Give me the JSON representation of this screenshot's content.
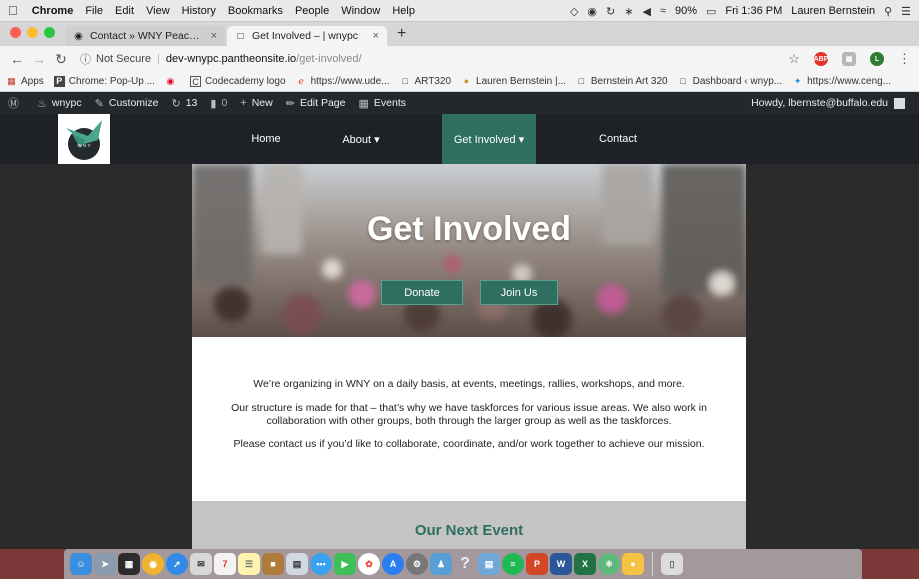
{
  "macos": {
    "menus": [
      "Chrome",
      "File",
      "Edit",
      "View",
      "History",
      "Bookmarks",
      "People",
      "Window",
      "Help"
    ],
    "battery": "90%",
    "clock": "Fri 1:36 PM",
    "user": "Lauren Bernstein"
  },
  "browser": {
    "tabs": [
      {
        "title": "Contact » WNY Peace Center",
        "close": "×",
        "active": false
      },
      {
        "title": "Get Involved – | wnypc",
        "close": "×",
        "active": true
      }
    ],
    "new_tab": "+",
    "security_label": "Not Secure",
    "url_host": "dev-wnypc.pantheonsite.io",
    "url_path": "/get-involved/",
    "bookmarks": [
      {
        "label": "Apps",
        "icon": "apps-grid-icon"
      },
      {
        "label": "Chrome: Pop-Up ...",
        "icon": "bookmark-favicon"
      },
      {
        "label": "",
        "icon": "pinterest-icon"
      },
      {
        "label": "Codecademy logo",
        "icon": "bookmark-favicon"
      },
      {
        "label": "https://www.ude...",
        "icon": "udemy-icon"
      },
      {
        "label": "ART320",
        "icon": "page-icon"
      },
      {
        "label": "Lauren Bernstein |...",
        "icon": "bookmark-favicon"
      },
      {
        "label": "Bernstein Art 320",
        "icon": "page-icon"
      },
      {
        "label": "Dashboard ‹ wnyp...",
        "icon": "page-icon"
      },
      {
        "label": "https://www.ceng...",
        "icon": "sparkle-icon"
      }
    ]
  },
  "wpadmin": {
    "items": [
      {
        "label": "wnypc",
        "icon": "home-icon"
      },
      {
        "label": "Customize",
        "icon": "brush-icon"
      },
      {
        "label": "13",
        "icon": "updates-icon"
      },
      {
        "label": "0",
        "icon": "comment-icon"
      },
      {
        "label": "New",
        "icon": "plus-icon"
      },
      {
        "label": "Edit Page",
        "icon": "pencil-icon"
      },
      {
        "label": "Events",
        "icon": "calendar-icon"
      }
    ],
    "howdy": "Howdy, lbernste@buffalo.edu"
  },
  "site": {
    "logo_text": "W N Y",
    "nav": [
      {
        "label": "Home"
      },
      {
        "label": "About ▾"
      },
      {
        "label": "Get Involved ▾"
      },
      {
        "label": "Contact"
      }
    ],
    "hero_title": "Get Involved",
    "hero_buttons": [
      "Donate",
      "Join Us"
    ],
    "paragraphs": [
      "We’re organizing in WNY on a daily basis, at events, meetings, rallies, workshops, and more.",
      "Our structure is made for that – that’s why we have taskforces for various issue areas. We also work in collaboration with other groups, both through the larger group as well as the taskforces.",
      "Please contact us if you’d like to collaborate, coordinate, and/or work together to achieve our mission."
    ],
    "next_event_title": "Our Next Event"
  },
  "colors": {
    "accent": "#2e6f5f",
    "wp_bar": "#23282d",
    "header_bg": "#1e2125"
  }
}
